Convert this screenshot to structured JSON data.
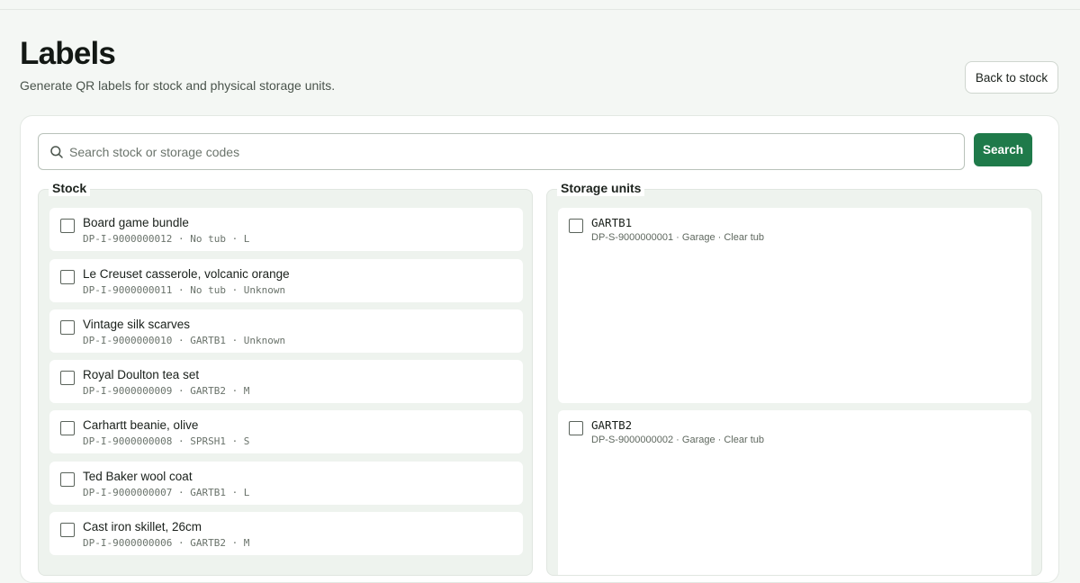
{
  "header": {
    "title": "Labels",
    "subtitle": "Generate QR labels for stock and physical storage units.",
    "back_label": "Back to stock"
  },
  "search": {
    "placeholder": "Search stock or storage codes",
    "value": "",
    "button_label": "Search"
  },
  "stock": {
    "heading": "Stock",
    "items": [
      {
        "title": "Board game bundle",
        "code": "DP-I-9000000012 · No tub · L",
        "checked": false
      },
      {
        "title": "Le Creuset casserole, volcanic orange",
        "code": "DP-I-9000000011 · No tub · Unknown",
        "checked": false
      },
      {
        "title": "Vintage silk scarves",
        "code": "DP-I-9000000010 · GARTB1 · Unknown",
        "checked": false
      },
      {
        "title": "Royal Doulton tea set",
        "code": "DP-I-9000000009 · GARTB2 · M",
        "checked": false
      },
      {
        "title": "Carhartt beanie, olive",
        "code": "DP-I-9000000008 · SPRSH1 · S",
        "checked": false
      },
      {
        "title": "Ted Baker wool coat",
        "code": "DP-I-9000000007 · GARTB1 · L",
        "checked": false
      },
      {
        "title": "Cast iron skillet, 26cm",
        "code": "DP-I-9000000006 · GARTB2 · M",
        "checked": false
      }
    ]
  },
  "storage": {
    "heading": "Storage units",
    "items": [
      {
        "title": "GARTB1",
        "meta": "DP-S-9000000001 · Garage · Clear tub",
        "checked": false
      },
      {
        "title": "GARTB2",
        "meta": "DP-S-9000000002 · Garage · Clear tub",
        "checked": false
      }
    ]
  },
  "colors": {
    "accent": "#1f7a4a",
    "background": "#f4f7f4",
    "panel": "#eef3ee"
  },
  "icons": {
    "search": "search-icon",
    "checkbox": "checkbox-icon"
  }
}
